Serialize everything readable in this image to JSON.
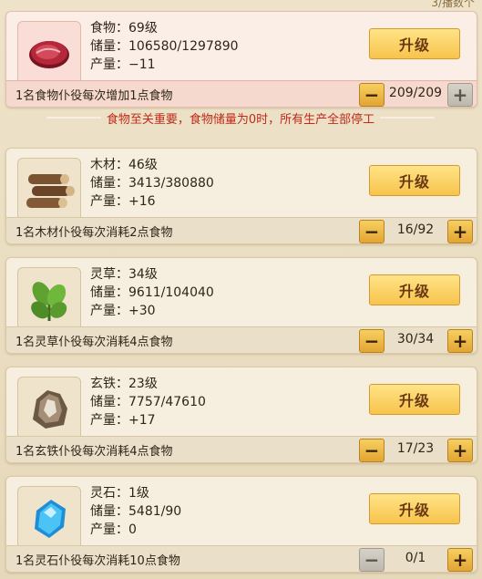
{
  "header_hint": "3/播数个",
  "upgrade_label": "升级",
  "warning": "食物至关重要，食物储量为0时，所有生产全部停工",
  "resources": [
    {
      "name_level": "食物：69级",
      "storage": "储量：106580/1297890",
      "output": "产量：−11",
      "worker_text": "1名食物仆役每次增加1点食物",
      "stepper": "209/209",
      "icon": "meat-icon"
    },
    {
      "name_level": "木材：46级",
      "storage": "储量：3413/380880",
      "output": "产量：+16",
      "worker_text": "1名木材仆役每次消耗2点食物",
      "stepper": "16/92",
      "icon": "wood-logs-icon"
    },
    {
      "name_level": "灵草：34级",
      "storage": "储量：9611/104040",
      "output": "产量：+30",
      "worker_text": "1名灵草仆役每次消耗4点食物",
      "stepper": "30/34",
      "icon": "herb-icon"
    },
    {
      "name_level": "玄铁：23级",
      "storage": "储量：7757/47610",
      "output": "产量：+17",
      "worker_text": "1名玄铁仆役每次消耗4点食物",
      "stepper": "17/23",
      "icon": "iron-ore-icon"
    },
    {
      "name_level": "灵石：1级",
      "storage": "储量：5481/90",
      "output": "产量：0",
      "worker_text": "1名灵石仆役每次消耗10点食物",
      "stepper": "0/1",
      "icon": "spirit-stone-icon"
    }
  ]
}
